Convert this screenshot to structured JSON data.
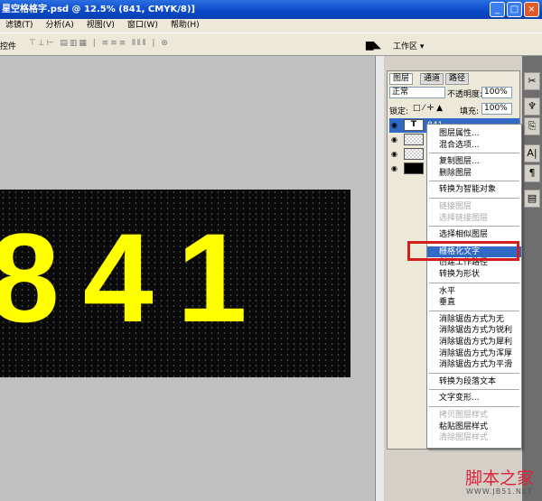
{
  "window": {
    "title": "星空格格字.psd @ 12.5% (841, CMYK/8)]",
    "min": "_",
    "max": "□",
    "close": "×"
  },
  "menu": [
    "滤镜(T)",
    "分析(A)",
    "视图(V)",
    "窗口(W)",
    "帮助(H)"
  ],
  "options": {
    "left_label": "控件",
    "workspace": "工作区 ▾"
  },
  "image_text": "841",
  "panel": {
    "tabs": [
      "图层",
      "通道",
      "路径"
    ],
    "blend": "正常",
    "opacity_label": "不透明度:",
    "opacity": "100%",
    "lock_label": "锁定:",
    "fill_label": "填充:",
    "fill": "100%",
    "layers": [
      {
        "name": "841",
        "type": "text"
      },
      {
        "name": "",
        "type": "transparent"
      },
      {
        "name": "",
        "type": "transparent"
      },
      {
        "name": "",
        "type": "black"
      }
    ]
  },
  "context_menu": [
    {
      "label": "图层属性...",
      "state": "normal"
    },
    {
      "label": "混合选项...",
      "state": "normal"
    },
    {
      "sep": true
    },
    {
      "label": "复制图层...",
      "state": "normal"
    },
    {
      "label": "删除图层",
      "state": "normal"
    },
    {
      "sep": true
    },
    {
      "label": "转换为智能对象",
      "state": "normal"
    },
    {
      "sep": true
    },
    {
      "label": "链接图层",
      "state": "disabled"
    },
    {
      "label": "选择链接图层",
      "state": "disabled"
    },
    {
      "sep": true
    },
    {
      "label": "选择相似图层",
      "state": "normal"
    },
    {
      "sep": true
    },
    {
      "label": "栅格化文字",
      "state": "highlighted"
    },
    {
      "label": "创建工作路径",
      "state": "normal"
    },
    {
      "label": "转换为形状",
      "state": "normal"
    },
    {
      "sep": true
    },
    {
      "label": "水平",
      "state": "normal"
    },
    {
      "label": "垂直",
      "state": "normal"
    },
    {
      "sep": true
    },
    {
      "label": "消除锯齿方式为无",
      "state": "normal"
    },
    {
      "label": "消除锯齿方式为锐利",
      "state": "normal"
    },
    {
      "label": "消除锯齿方式为犀利",
      "state": "normal"
    },
    {
      "label": "消除锯齿方式为浑厚",
      "state": "normal"
    },
    {
      "label": "消除锯齿方式为平滑",
      "state": "normal"
    },
    {
      "sep": true
    },
    {
      "label": "转换为段落文本",
      "state": "normal"
    },
    {
      "sep": true
    },
    {
      "label": "文字变形...",
      "state": "normal"
    },
    {
      "sep": true
    },
    {
      "label": "拷贝图层样式",
      "state": "disabled"
    },
    {
      "label": "粘贴图层样式",
      "state": "normal"
    },
    {
      "label": "清除图层样式",
      "state": "disabled"
    }
  ],
  "watermark": {
    "name": "脚本之家",
    "url": "WWW.JB51.NET"
  },
  "colors": {
    "title": "#0a48c8",
    "highlight": "#316ac5",
    "text_yellow": "#ffff00",
    "annotation_red": "#d41e1e"
  }
}
